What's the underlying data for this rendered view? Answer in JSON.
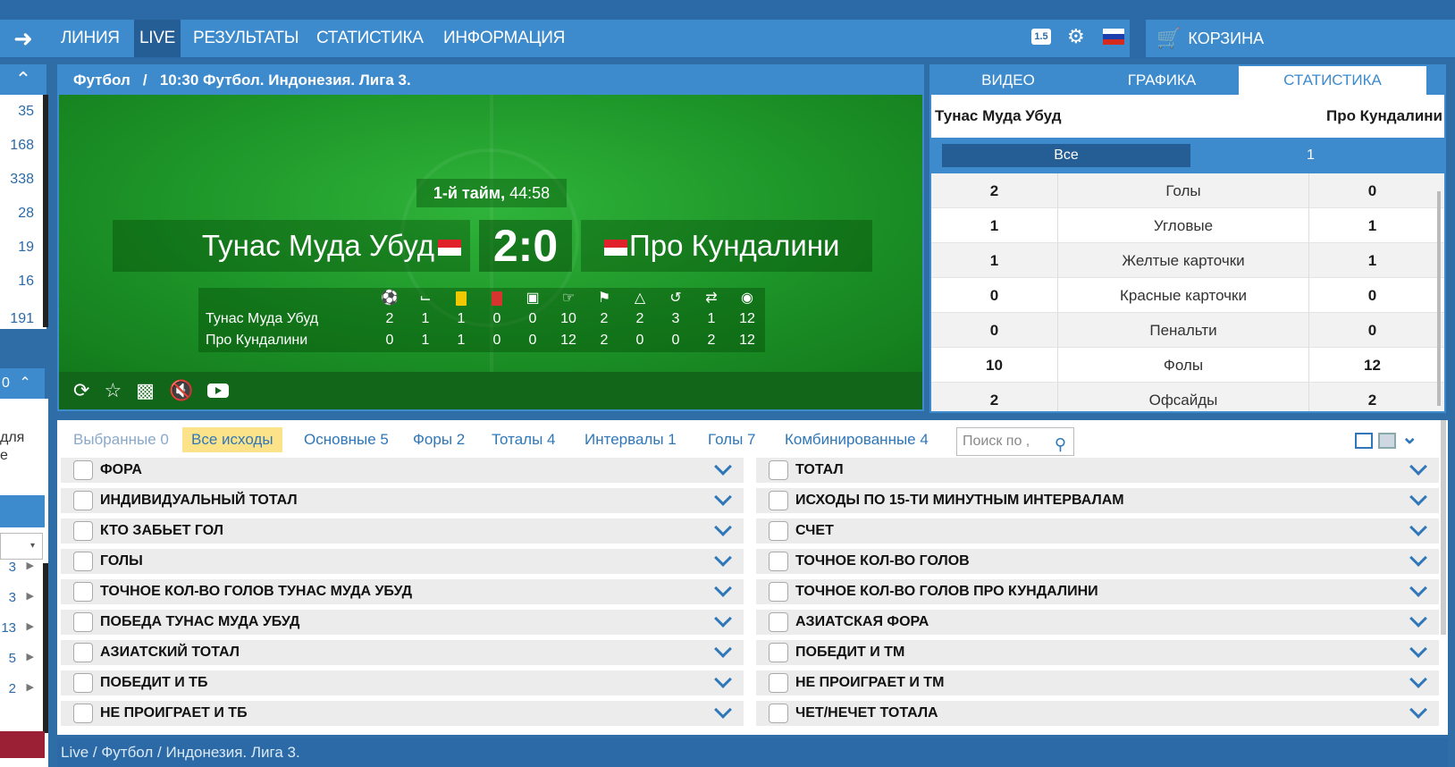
{
  "nav": {
    "items": [
      "ЛИНИЯ",
      "LIVE",
      "РЕЗУЛЬТАТЫ",
      "СТАТИСТИКА",
      "ИНФОРМАЦИЯ"
    ],
    "odds_badge": "1.5",
    "cart_label": "КОРЗИНА"
  },
  "sidebar": {
    "counts": [
      "35",
      "168",
      "338",
      "28",
      "19",
      "16",
      "191"
    ],
    "mid_box": "0",
    "partial_text": [
      "для",
      "е"
    ],
    "rows": [
      "3",
      "3",
      "13",
      "5",
      "2"
    ]
  },
  "match": {
    "title": "Футбол   /   10:30 Футбол. Индонезия. Лига 3.",
    "period": "1-й тайм,",
    "time": "44:58",
    "team1": "Тунас Муда Убуд",
    "team2": "Про Кундалини",
    "score": "2:0",
    "stats_team1": [
      "2",
      "1",
      "1",
      "0",
      "0",
      "10",
      "2",
      "2",
      "3",
      "1",
      "12"
    ],
    "stats_team2": [
      "0",
      "1",
      "1",
      "0",
      "0",
      "12",
      "2",
      "0",
      "0",
      "2",
      "12"
    ]
  },
  "stats_panel": {
    "tabs": [
      "ВИДЕО",
      "ГРАФИКА",
      "СТАТИСТИКА"
    ],
    "team1": "Тунас Муда Убуд",
    "team2": "Про Кундалини",
    "filter_all": "Все",
    "filter_1": "1",
    "rows": [
      {
        "l": "2",
        "c": "Голы",
        "r": "0"
      },
      {
        "l": "1",
        "c": "Угловые",
        "r": "1"
      },
      {
        "l": "1",
        "c": "Желтые карточки",
        "r": "1"
      },
      {
        "l": "0",
        "c": "Красные карточки",
        "r": "0"
      },
      {
        "l": "0",
        "c": "Пенальти",
        "r": "0"
      },
      {
        "l": "10",
        "c": "Фолы",
        "r": "12"
      },
      {
        "l": "2",
        "c": "Офсайды",
        "r": "2"
      }
    ]
  },
  "markets": {
    "tabs": [
      "Выбранные 0",
      "Все исходы",
      "Основные 5",
      "Форы 2",
      "Тоталы 4",
      "Интервалы 1",
      "Голы 7",
      "Комбинированные 4"
    ],
    "search_placeholder": "Поиск по ,",
    "left": [
      "ФОРА",
      "ИНДИВИДУАЛЬНЫЙ ТОТАЛ",
      "КТО ЗАБЬЕТ ГОЛ",
      "ГОЛЫ",
      "ТОЧНОЕ КОЛ-ВО ГОЛОВ ТУНАС МУДА УБУД",
      "ПОБЕДА ТУНАС МУДА УБУД",
      "АЗИАТСКИЙ ТОТАЛ",
      "ПОБЕДИТ И ТБ",
      "НЕ ПРОИГРАЕТ И ТБ"
    ],
    "right": [
      "ТОТАЛ",
      "ИСХОДЫ ПО 15-ТИ МИНУТНЫМ ИНТЕРВАЛАМ",
      "СЧЕТ",
      "ТОЧНОЕ КОЛ-ВО ГОЛОВ",
      "ТОЧНОЕ КОЛ-ВО ГОЛОВ ПРО КУНДАЛИНИ",
      "АЗИАТСКАЯ ФОРА",
      "ПОБЕДИТ И ТМ",
      "НЕ ПРОИГРАЕТ И ТМ",
      "ЧЕТ/НЕЧЕТ ТОТАЛА"
    ]
  },
  "breadcrumb": "Live / Футбол / Индонезия. Лига 3.",
  "colors": {
    "accent": "#3d8bcd",
    "dark_blue": "#2b6aa6",
    "pitch": "#1f8a2a",
    "active_tab": "#fce38a"
  }
}
